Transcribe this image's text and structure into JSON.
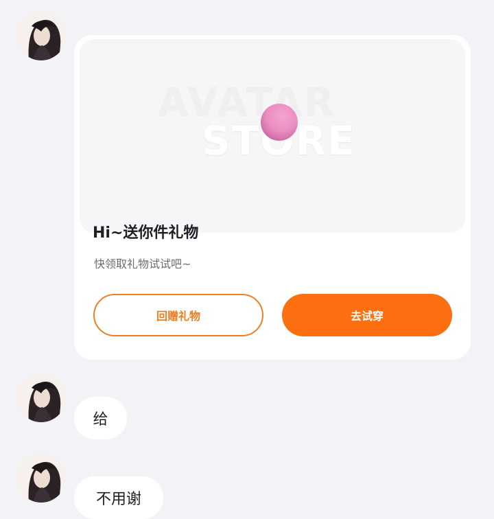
{
  "messages": [
    {
      "type": "gift-card",
      "avatar_icon": "user-avatar-icon",
      "banner": {
        "watermark_line1": "AVATAR",
        "watermark_line2": "STORE",
        "ball_icon": "pink-ball-icon"
      },
      "title": "Hi~送你件礼物",
      "subtitle": "快领取礼物试试吧~",
      "buttons": {
        "return_gift_label": "回赠礼物",
        "try_on_label": "去试穿"
      }
    },
    {
      "type": "text",
      "avatar_icon": "user-avatar-icon",
      "text": "给"
    },
    {
      "type": "text",
      "avatar_icon": "user-avatar-icon",
      "text": "不用谢"
    }
  ],
  "colors": {
    "page_background": "#f3f3f7",
    "bubble_background": "#ffffff",
    "accent_orange": "#fb6f10",
    "outline_orange": "#ef7d22",
    "ball_pink": "#ea8cc0"
  }
}
